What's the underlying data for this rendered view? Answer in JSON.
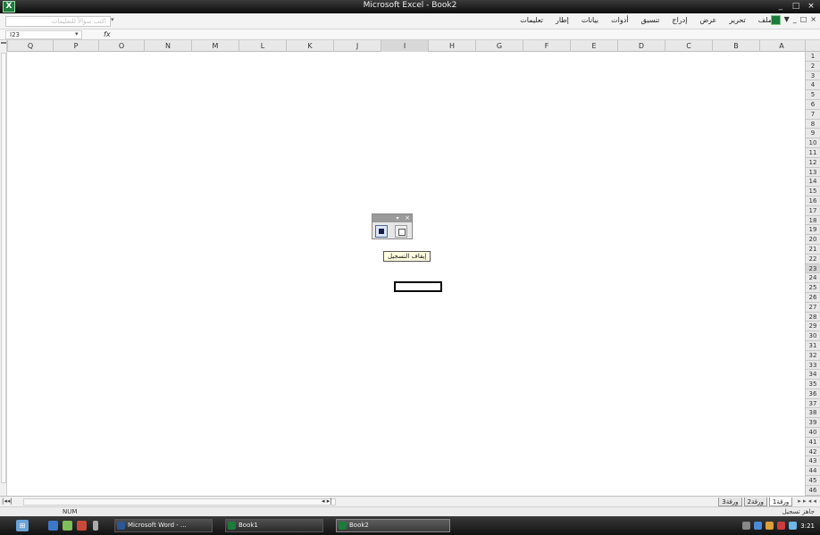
{
  "window": {
    "title": "Microsoft Excel - Book2",
    "controls": [
      "_",
      "□",
      "×"
    ],
    "icon": "excel-icon"
  },
  "menubar": {
    "help_placeholder": "اكتب سؤالاً للتعليمات",
    "menus": [
      "ملف",
      "تحرير",
      "عرض",
      "إدراج",
      "تنسيق",
      "أدوات",
      "بيانات",
      "إطار",
      "تعليمات"
    ],
    "mdi_controls": [
      "▼",
      "_",
      "□",
      "×"
    ]
  },
  "formulabar": {
    "namebox": "I23",
    "fx": "fx"
  },
  "columns": [
    "Q",
    "P",
    "O",
    "N",
    "M",
    "L",
    "K",
    "J",
    "I",
    "H",
    "G",
    "F",
    "E",
    "D",
    "C",
    "B",
    "A"
  ],
  "active_column": "I",
  "rows": [
    "1",
    "2",
    "3",
    "4",
    "5",
    "6",
    "7",
    "8",
    "9",
    "10",
    "11",
    "12",
    "13",
    "14",
    "15",
    "16",
    "17",
    "18",
    "19",
    "20",
    "21",
    "22",
    "23",
    "24",
    "25",
    "26",
    "27",
    "28",
    "29",
    "30",
    "31",
    "32",
    "33",
    "34",
    "35",
    "36",
    "37",
    "38",
    "39",
    "40",
    "41",
    "42",
    "43",
    "44",
    "45",
    "46"
  ],
  "active_row": "23",
  "stop_toolbar": {
    "dropdown": "▾",
    "close": "×",
    "tooltip": "إيقاف التسجيل"
  },
  "sheet_nav": {
    "left": "|◂◂|",
    "arrows": "◂ ▸|",
    "right_nav": "◂ ◂ ▸ ▸"
  },
  "sheet_tabs": [
    "ورقة1",
    "ورقة2",
    "ورقة3"
  ],
  "active_sheet": "ورقة1",
  "statusbar": {
    "num": "NUM",
    "ready": "جاهز  تسجيل"
  },
  "taskbar": {
    "start_icon": "windows-start-icon",
    "tasks": [
      {
        "label": "Microsoft Word - ...",
        "icon_color": "#2b5797"
      },
      {
        "label": "Book1",
        "icon_color": "#1d7b3c"
      },
      {
        "label": "Book2",
        "icon_color": "#1d7b3c"
      }
    ],
    "clock": "3:21"
  }
}
